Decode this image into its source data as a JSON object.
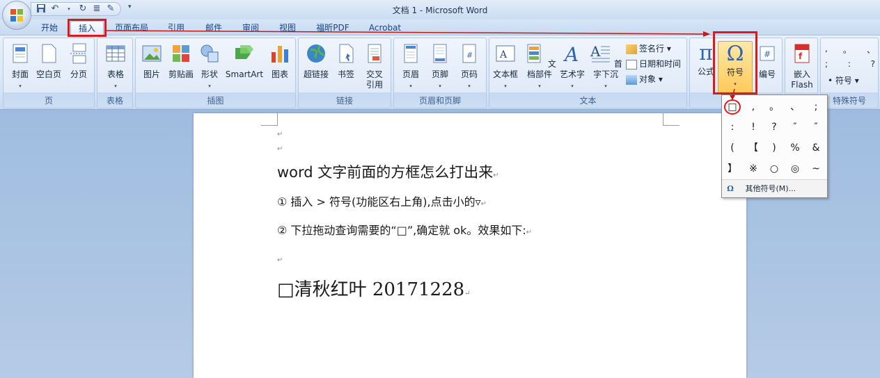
{
  "window": {
    "title": "文档 1 - Microsoft Word"
  },
  "quick_access": {
    "icons": [
      "save-icon",
      "undo-icon",
      "redo-icon",
      "format-icon",
      "edit-icon",
      "customize-icon"
    ]
  },
  "tabs": [
    {
      "label": "开始"
    },
    {
      "label": "插入"
    },
    {
      "label": "页面布局"
    },
    {
      "label": "引用"
    },
    {
      "label": "邮件"
    },
    {
      "label": "审阅"
    },
    {
      "label": "视图"
    },
    {
      "label": "福昕PDF"
    },
    {
      "label": "Acrobat"
    }
  ],
  "ribbon": {
    "groups": {
      "page": "页",
      "table": "表格",
      "illustrations": "插图",
      "links": "链接",
      "header_footer": "页眉和页脚",
      "text": "文本",
      "symbols": "",
      "flash": "",
      "special": "特殊符号"
    },
    "buttons": {
      "cover": "封面",
      "blank": "空白页",
      "pagebreak": "分页",
      "table": "表格",
      "picture": "图片",
      "clipart": "剪贴画",
      "shapes": "形状",
      "smartart": "SmartArt",
      "chart": "图表",
      "hyperlink": "超链接",
      "bookmark": "书签",
      "crossref1": "交叉",
      "crossref2": "引用",
      "header": "页眉",
      "footer": "页脚",
      "pagenum": "页码",
      "textbox": "文本框",
      "quickparts": "文档部件",
      "wordart": "艺术字",
      "dropcap": "首字下沉",
      "signature": "签名行 ▾",
      "datetime": "日期和时间",
      "object": "对象 ▾",
      "equation": "公式",
      "symbol": "符号",
      "number": "编号",
      "flash1": "嵌入",
      "flash2": "Flash",
      "special_row1": [
        ",",
        "。",
        "、"
      ],
      "special_row2": [
        ";",
        ":",
        "?"
      ],
      "special_symbol": "符号 ▾"
    }
  },
  "symbol_dropdown": {
    "grid": [
      [
        "□",
        ",",
        "。",
        "、",
        ";"
      ],
      [
        ":",
        "!",
        "?",
        "″",
        "″"
      ],
      [
        "(",
        "【",
        ")",
        "%",
        "&"
      ],
      [
        "】",
        "※",
        "○",
        "◎",
        "~"
      ]
    ],
    "more": "其他符号(M)..."
  },
  "document": {
    "paragraph_mark": "↵",
    "heading": "word 文字前面的方框怎么打出来",
    "step1": "① 插入 > 符号(功能区右上角),点击小的▿",
    "step2": "② 下拉拖动查询需要的“□”,确定就 ok。效果如下:",
    "result": "□清秋红叶 20171228"
  }
}
